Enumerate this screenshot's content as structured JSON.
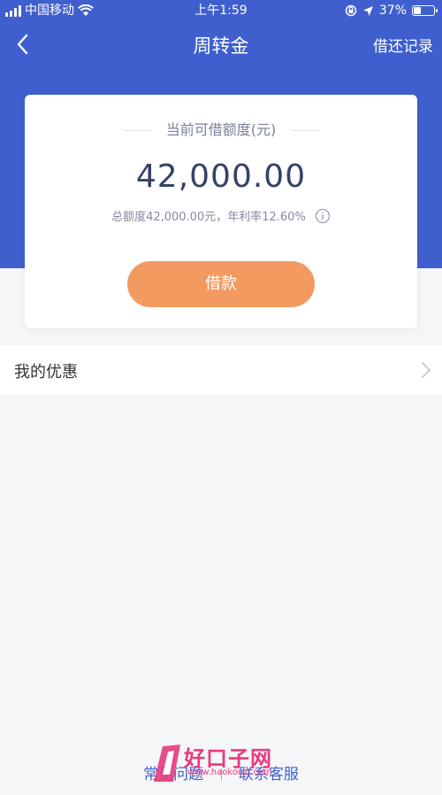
{
  "status_bar": {
    "carrier": "中国移动",
    "time": "上午1:59",
    "battery": "37%",
    "battery_level": 0.37
  },
  "nav": {
    "title": "周转金",
    "right_action": "借还记录"
  },
  "card": {
    "label": "当前可借额度(元)",
    "amount": "42,000.00",
    "sub_text": "总额度42,000.00元，年利率12.60%",
    "borrow_label": "借款"
  },
  "list": {
    "discount_label": "我的优惠"
  },
  "footer": {
    "faq": "常见问题",
    "contact": "联系客服"
  },
  "watermark": {
    "text": "好口子网",
    "url": "www.haokouzi.com"
  },
  "colors": {
    "brand_blue": "#3f5fce",
    "button_orange": "#f39a61",
    "amount_text": "#354168"
  }
}
